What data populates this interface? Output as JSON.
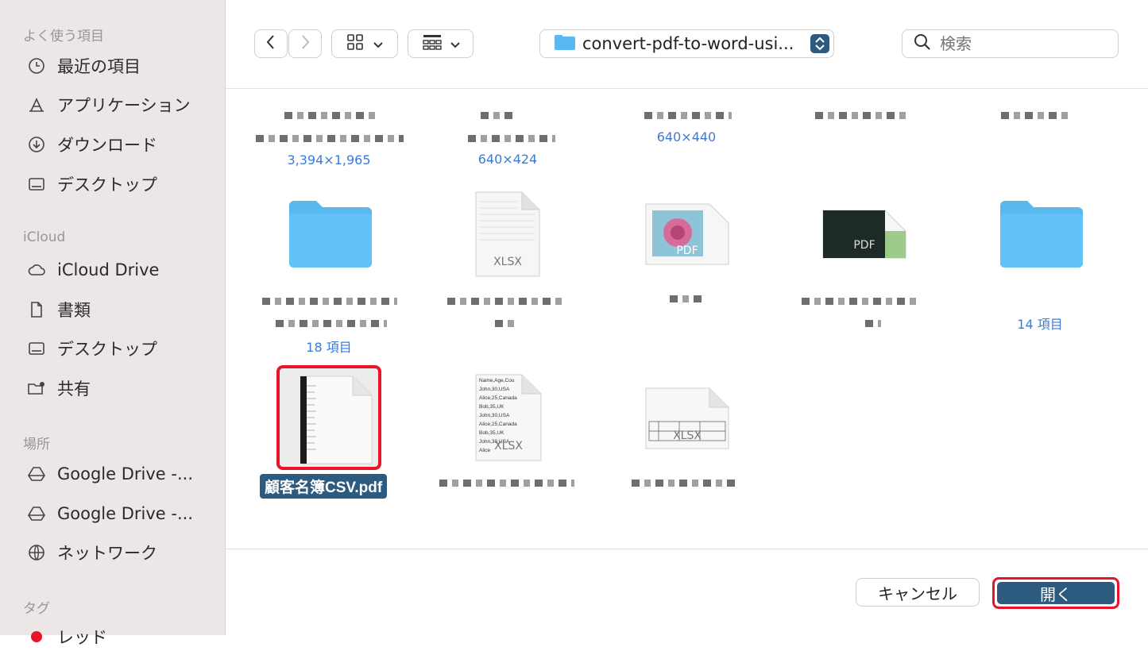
{
  "sidebar": {
    "favorites_title": "よく使う項目",
    "favorites": [
      {
        "label": "最近の項目",
        "icon": "clock-icon"
      },
      {
        "label": "アプリケーション",
        "icon": "apps-icon"
      },
      {
        "label": "ダウンロード",
        "icon": "download-icon"
      },
      {
        "label": "デスクトップ",
        "icon": "desktop-icon"
      }
    ],
    "icloud_title": "iCloud",
    "icloud": [
      {
        "label": "iCloud Drive",
        "icon": "cloud-icon"
      },
      {
        "label": "書類",
        "icon": "document-icon"
      },
      {
        "label": "デスクトップ",
        "icon": "desktop-icon"
      },
      {
        "label": "共有",
        "icon": "shared-folder-icon"
      }
    ],
    "places_title": "場所",
    "places": [
      {
        "label": "Google Drive -...",
        "icon": "drive-icon"
      },
      {
        "label": "Google Drive -...",
        "icon": "drive-icon"
      },
      {
        "label": "ネットワーク",
        "icon": "globe-icon"
      }
    ],
    "tags_title": "タグ",
    "tags": [
      {
        "label": "レッド",
        "color": "#e8142a"
      }
    ]
  },
  "toolbar": {
    "path_label": "convert-pdf-to-word-usi...",
    "search_placeholder": "検索"
  },
  "files": {
    "row1_meta": [
      "3,394×1,965",
      "640×424",
      "640×440"
    ],
    "row2_meta": [
      "18 項目",
      "14 項目"
    ],
    "xlsx_label": "XLSX",
    "pdf_label": "PDF",
    "selected_file": "顧客名簿CSV.pdf",
    "csv_preview_lines": [
      "Name,Age,Cou",
      "John,30,USA",
      "Alice,25,Canada",
      "Bob,35,UK",
      "John,30,USA",
      "Alice,25,Canada",
      "Bob,35,UK",
      "John,30,USA",
      "Alice"
    ]
  },
  "footer": {
    "cancel_label": "キャンセル",
    "open_label": "開く"
  },
  "colors": {
    "accent": "#2d5b80",
    "highlight": "#e8142a",
    "folder": "#5ab8f0",
    "link": "#3a7bd5"
  }
}
